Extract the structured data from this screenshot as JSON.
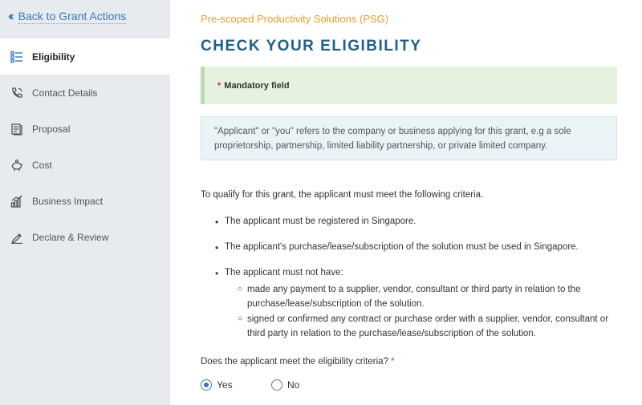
{
  "sidebar": {
    "back_label": "Back to Grant Actions",
    "items": [
      {
        "label": "Eligibility",
        "icon": "checklist-icon",
        "active": true
      },
      {
        "label": "Contact Details",
        "icon": "phone-icon",
        "active": false
      },
      {
        "label": "Proposal",
        "icon": "document-icon",
        "active": false
      },
      {
        "label": "Cost",
        "icon": "piggy-bank-icon",
        "active": false
      },
      {
        "label": "Business Impact",
        "icon": "bar-chart-icon",
        "active": false
      },
      {
        "label": "Declare & Review",
        "icon": "pen-icon",
        "active": false
      }
    ]
  },
  "main": {
    "subtitle": "Pre-scoped Productivity Solutions (PSG)",
    "title": "CHECK YOUR ELIGIBILITY",
    "mandatory_star": "*",
    "mandatory_label": "Mandatory field",
    "info_text": "\"Applicant\" or \"you\" refers to the company or business applying for this grant, e.g a sole proprietorship, partnership, limited liability partnership, or private limited company.",
    "criteria_intro": "To qualify for this grant, the applicant must meet the following criteria.",
    "bullets": [
      "The applicant must be registered in Singapore.",
      "The applicant's purchase/lease/subscription of the solution must be used in Singapore.",
      "The applicant must not have:"
    ],
    "sub_bullets": [
      "made any payment to a supplier, vendor, consultant or third party in relation to the purchase/lease/subscription of the solution.",
      "signed or confirmed any contract or purchase order with a supplier, vendor, consultant or third party in relation to the purchase/lease/subscription of the solution."
    ],
    "question": "Does the applicant meet the eligibility criteria?",
    "question_star": "*",
    "options": [
      {
        "label": "Yes",
        "selected": true
      },
      {
        "label": "No",
        "selected": false
      }
    ]
  },
  "colors": {
    "accent": "#3a7ab8",
    "title": "#1f5f86",
    "subtitle": "#e0a029",
    "mandatory_bg": "#e4f2df",
    "info_bg": "#eaf4f6",
    "sidebar_bg": "#e7eaee"
  }
}
